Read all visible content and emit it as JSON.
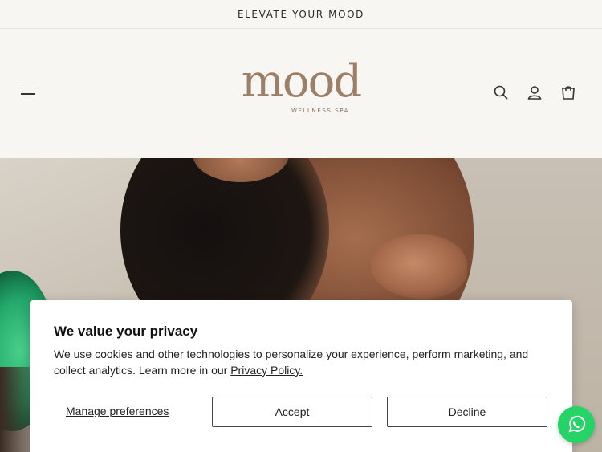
{
  "announcement": {
    "text": "ELEVATE YOUR MOOD"
  },
  "header": {
    "logo_wordmark": "mood",
    "logo_tagline": "WELLNESS SPA",
    "icons": [
      "menu-icon",
      "search-icon",
      "account-icon",
      "cart-icon"
    ]
  },
  "consent": {
    "title": "We value your privacy",
    "body": "We use cookies and other technologies to personalize your experience, perform marketing, and collect analytics. Learn more in our ",
    "policy_link": "Privacy Policy.",
    "manage_label": "Manage preferences",
    "accept_label": "Accept",
    "decline_label": "Decline"
  },
  "chat": {
    "icon": "whatsapp-icon",
    "color": "#25d366"
  },
  "colors": {
    "brand": "#9c7f68",
    "background": "#f8f6f3"
  }
}
